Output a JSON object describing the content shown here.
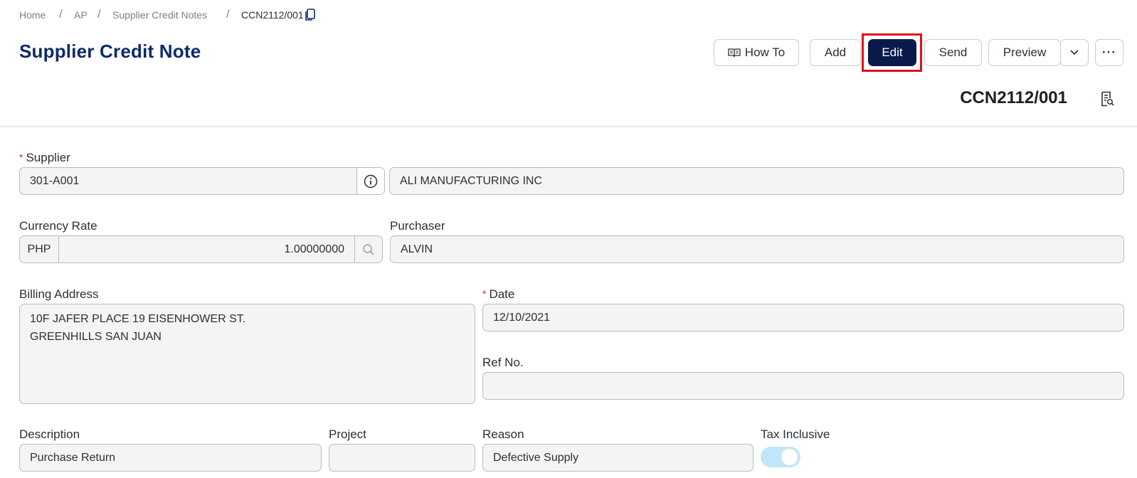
{
  "breadcrumb": [
    "Home",
    "AP",
    "Supplier Credit Notes",
    "CCN2112/001"
  ],
  "page_title": "Supplier Credit Note",
  "toolbar": {
    "how_to": "How To",
    "add": "Add",
    "edit": "Edit",
    "send": "Send",
    "preview": "Preview",
    "more": "···"
  },
  "doc_number": "CCN2112/001",
  "form": {
    "supplier": {
      "label": "Supplier",
      "code": "301-A001",
      "name": "ALI MANUFACTURING INC"
    },
    "currency_rate": {
      "label": "Currency Rate",
      "currency": "PHP",
      "rate": "1.00000000"
    },
    "purchaser": {
      "label": "Purchaser",
      "value": "ALVIN"
    },
    "billing_address": {
      "label": "Billing Address",
      "value": "10F JAFER PLACE 19 EISENHOWER ST.\nGREENHILLS SAN JUAN"
    },
    "date": {
      "label": "Date",
      "value": "12/10/2021"
    },
    "ref_no": {
      "label": "Ref No.",
      "value": ""
    },
    "description": {
      "label": "Description",
      "value": "Purchase Return"
    },
    "project": {
      "label": "Project",
      "value": ""
    },
    "reason": {
      "label": "Reason",
      "value": "Defective Supply"
    },
    "tax_inclusive": {
      "label": "Tax Inclusive",
      "enabled": true
    }
  },
  "colors": {
    "title": "#0e2a6b",
    "primary_button": "#0a1a4a",
    "highlight": "#e0101c",
    "toggle_track": "#bfe7f7",
    "required": "#d8262e"
  }
}
